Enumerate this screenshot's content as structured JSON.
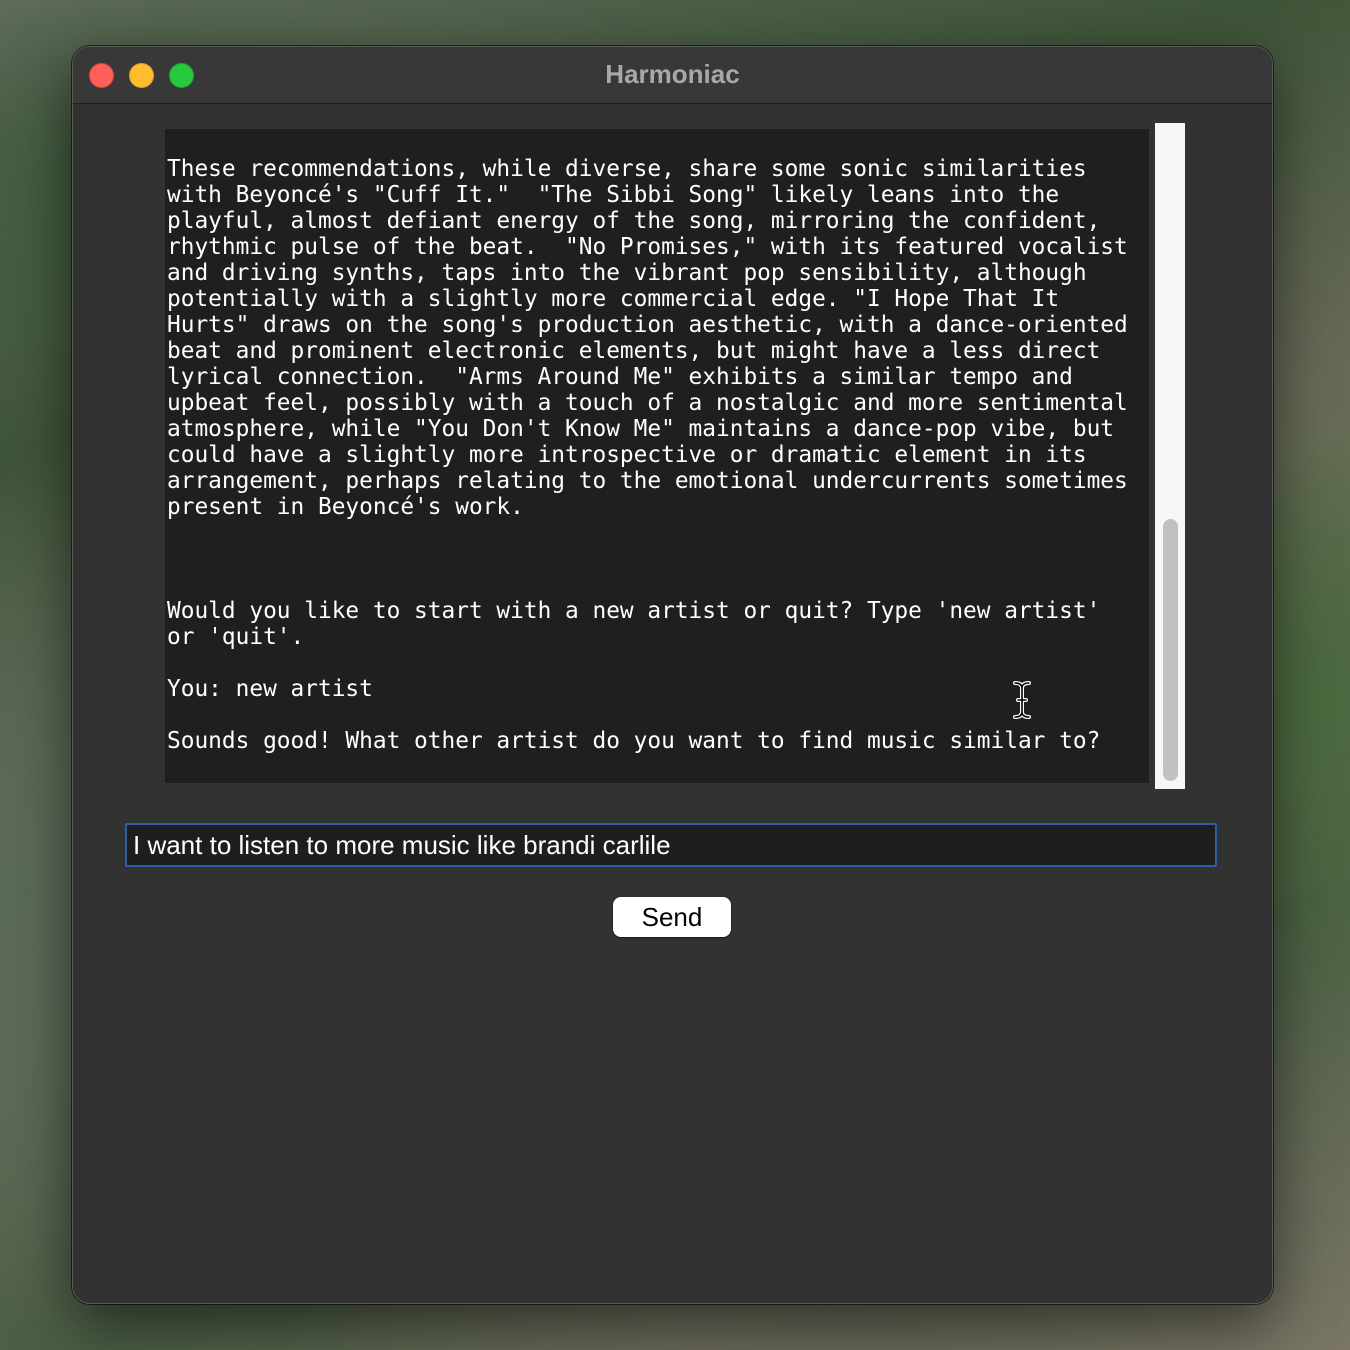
{
  "window": {
    "title": "Harmoniac"
  },
  "chat": {
    "transcript": "These recommendations, while diverse, share some sonic similarities\nwith Beyoncé's \"Cuff It.\"  \"The Sibbi Song\" likely leans into the\nplayful, almost defiant energy of the song, mirroring the confident,\nrhythmic pulse of the beat.  \"No Promises,\" with its featured vocalist\nand driving synths, taps into the vibrant pop sensibility, although\npotentially with a slightly more commercial edge. \"I Hope That It\nHurts\" draws on the song's production aesthetic, with a dance-oriented\nbeat and prominent electronic elements, but might have a less direct\nlyrical connection.  \"Arms Around Me\" exhibits a similar tempo and\nupbeat feel, possibly with a touch of a nostalgic and more sentimental\natmosphere, while \"You Don't Know Me\" maintains a dance-pop vibe, but\ncould have a slightly more introspective or dramatic element in its\narrangement, perhaps relating to the emotional undercurrents sometimes\npresent in Beyoncé's work.\n\n\n\nWould you like to start with a new artist or quit? Type 'new artist'\nor 'quit'.\n\nYou: new artist\n\nSounds good! What other artist do you want to find music similar to?"
  },
  "input": {
    "value": "I want to listen to more music like brandi carlile"
  },
  "buttons": {
    "send_label": "Send"
  },
  "colors": {
    "window_bg": "#323232",
    "chat_bg": "#1f1f1f",
    "input_focus_border": "#2f5ea8",
    "close": "#fe5f57",
    "minimize": "#febc2e",
    "maximize": "#28c840"
  },
  "icons": {
    "cursor": "ibeam-cursor-icon"
  }
}
